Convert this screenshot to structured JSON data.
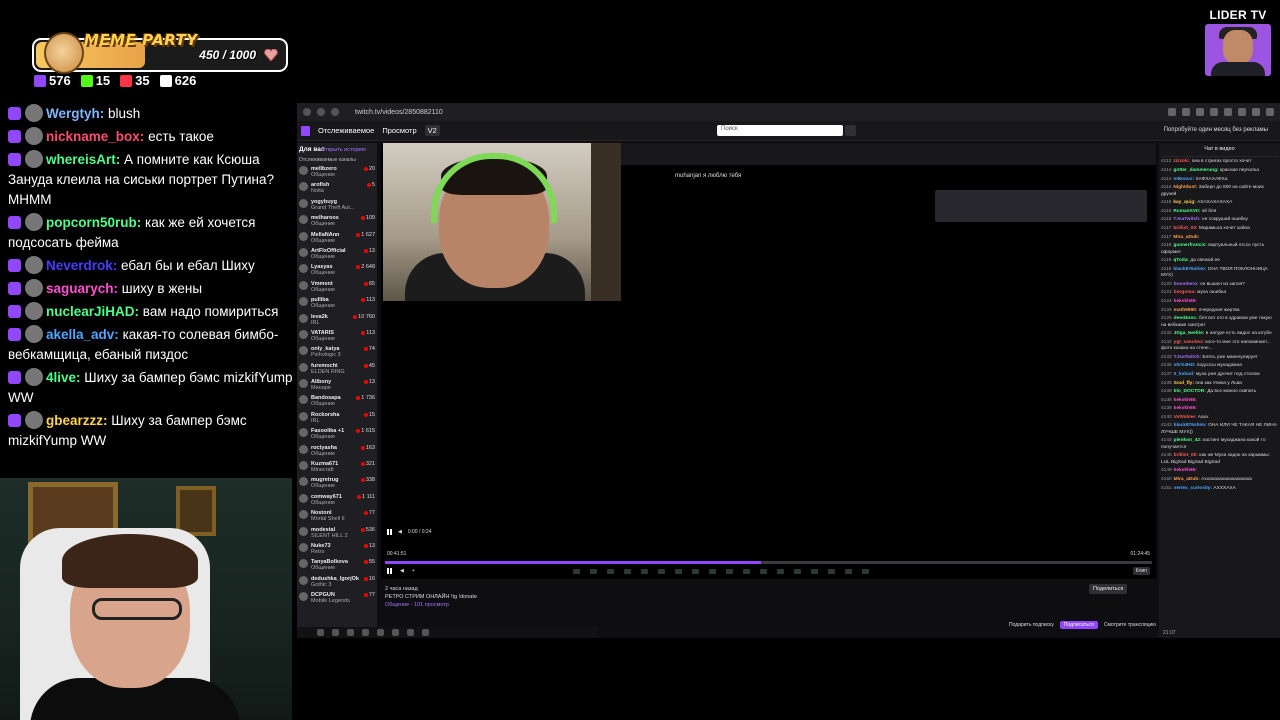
{
  "goal": {
    "title": "MEME PARTY",
    "value": "450 / 1000",
    "progress": 0.45,
    "accent": "#f6c860"
  },
  "stats": [
    {
      "icon": "twitch-icon",
      "color": "#9146ff",
      "value": "576"
    },
    {
      "icon": "kick-icon",
      "color": "#53fc18",
      "value": "15"
    },
    {
      "icon": "vk-icon",
      "color": "#ff3347",
      "value": "35"
    },
    {
      "icon": "viewers-icon",
      "color": "#ffffff",
      "value": "626"
    }
  ],
  "chat": [
    {
      "name": "Wergtyh:",
      "color": "#7fb4ff",
      "text": "blush"
    },
    {
      "name": "nickname_box:",
      "color": "#ff4d6d",
      "text": "есть такое"
    },
    {
      "name": "whereisArt:",
      "color": "#4dff88",
      "text": "А помните как Ксюша Зануда клеила на сиськи портрет Путина? МНММ"
    },
    {
      "name": "popcorn50rub:",
      "color": "#4dff88",
      "text": "как же ей хочется подсосать фейма"
    },
    {
      "name": "Neverdrok:",
      "color": "#4a3cff",
      "text": "ебал бы и ебал Шиху"
    },
    {
      "name": "saguarych:",
      "color": "#ff4fcf",
      "text": "шиху в жены"
    },
    {
      "name": "nuclearJiHAD:",
      "color": "#4dff88",
      "text": "вам надо помириться"
    },
    {
      "name": "akella_adv:",
      "color": "#4da6ff",
      "text": "какая-то солевая бимбо-вебкамщица, ебаный пиздос"
    },
    {
      "name": "4live:",
      "color": "#4dff88",
      "text": "Шиху за бампер бэмс mizkifYump WW"
    },
    {
      "name": "gbearzzz:",
      "color": "#ffd34d",
      "text": "Шиху за бампер бэмс mizkifYump WW"
    }
  ],
  "logo": {
    "text": "LIDER TV"
  },
  "browser": {
    "url": "twitch.tv/videos/2850882110",
    "nav": {
      "following": "Отслеживаемое",
      "browse": "Просмотр",
      "badge": "V2"
    },
    "search_placeholder": "Поиск",
    "promo": "Попробуйте один месяц без рекламы",
    "sidenav": {
      "title": "Для вас",
      "open_history": "Открыть историю",
      "section": "Отслеживаемые каналы",
      "channels": [
        {
          "name": "mellbzero",
          "game": "Общение",
          "viewers": "20"
        },
        {
          "name": "aroflsh",
          "game": "Noita",
          "viewers": "5"
        },
        {
          "name": "yogybuyg",
          "game": "Grand Theft Aut...",
          "viewers": ""
        },
        {
          "name": "melharoos",
          "game": "Общение",
          "viewers": "109"
        },
        {
          "name": "MellaNAnn",
          "game": "Общение",
          "viewers": "1 627"
        },
        {
          "name": "ArtFIxOfficial",
          "game": "Общение",
          "viewers": "13"
        },
        {
          "name": "Lyasyas",
          "game": "Общение",
          "viewers": "2 648"
        },
        {
          "name": "Vmment",
          "game": "Общение",
          "viewers": "65"
        },
        {
          "name": "pulliba",
          "game": "Общение",
          "viewers": "113"
        },
        {
          "name": "leva2k",
          "game": "IRL",
          "viewers": "10 760"
        },
        {
          "name": "VATARIS",
          "game": "Общение",
          "viewers": "113"
        },
        {
          "name": "only_katya",
          "game": "Psihologic 3",
          "viewers": "74"
        },
        {
          "name": "furemochi",
          "game": "ELDEN RING",
          "viewers": "45"
        },
        {
          "name": "Alibony",
          "game": "Минаре",
          "viewers": "13"
        },
        {
          "name": "Bandosapa",
          "game": "Общение",
          "viewers": "1 736"
        },
        {
          "name": "Rockorsha",
          "game": "IRL",
          "viewers": "15"
        },
        {
          "name": "Fasoolika +1",
          "game": "Общение",
          "viewers": "1 615"
        },
        {
          "name": "roctyasha",
          "game": "Общение",
          "viewers": "163"
        },
        {
          "name": "Kuzma671",
          "game": "Minecraft",
          "viewers": "321"
        },
        {
          "name": "mugretrug",
          "game": "Общение",
          "viewers": "338"
        },
        {
          "name": "comway671",
          "game": "Общение",
          "viewers": "1 111"
        },
        {
          "name": "Nostonl",
          "game": "Mortal Shell II",
          "viewers": "77"
        },
        {
          "name": "modestal",
          "game": "SILENT HILL 2",
          "viewers": "536"
        },
        {
          "name": "Nuke73",
          "game": "Retro",
          "viewers": "13"
        },
        {
          "name": "TanyaBolkova",
          "game": "Общение",
          "viewers": "55"
        },
        {
          "name": "dedushka_lgorjOk",
          "game": "Gothic 3",
          "viewers": "16"
        },
        {
          "name": "DCPGUN",
          "game": "Mobile Legends",
          "viewers": "77"
        }
      ]
    },
    "inner_title": "muhanjan я люблю тебя",
    "inner_time": "0:00 / 0:24",
    "seek": {
      "elapsed": "00:41:51",
      "total": "01:24:45",
      "progress": 0.49
    },
    "clip_label": "Клип",
    "video": {
      "ago": "2 часа назад",
      "title": "РЕТРО СТРИМ ОНЛАЙН !tg !donate",
      "category": "Общение",
      "views": "101 просмотр"
    },
    "share": "Поделиться",
    "bottom": {
      "sub": "Подарить подписку",
      "follow": "Подписаться",
      "watch": "Смотрите трансляцию"
    },
    "vchat": {
      "header": "Чат в видео",
      "messages": [
        {
          "ts": "4112",
          "user": "zizzolc:",
          "color": "#ff5a5a",
          "text": "она в стригах просто хочет"
        },
        {
          "ts": "4114",
          "user": "gotter_dammerung:",
          "color": "#4dff88",
          "text": "красная перчатка"
        },
        {
          "ts": "4114",
          "user": "mBonus:",
          "color": "#4da6ff",
          "text": "ХАФХАХАФХа"
        },
        {
          "ts": "4114",
          "user": "Nightdust:",
          "color": "#ff9f4d",
          "text": "Заберн до 800 на сайте моих друзей"
        },
        {
          "ts": "4116",
          "user": "kay_quig:",
          "color": "#ffd34d",
          "text": "АХАХАХАХАХА"
        },
        {
          "ts": "4116",
          "user": "RomanXVII:",
          "color": "#4dff88",
          "text": "ой бля"
        },
        {
          "ts": "4116",
          "user": "TJsaTwitch:",
          "color": "#a970ff",
          "text": "не сокрушай ошибку"
        },
        {
          "ts": "4117",
          "user": "brilliot_00:",
          "color": "#ff5a5a",
          "text": "Марамыга хочет хайпа"
        },
        {
          "ts": "4117",
          "user": "Mira_aDub:",
          "color": "#ff9f4d",
          "text": ""
        },
        {
          "ts": "4118",
          "user": "gunnerfrancis:",
          "color": "#4dff88",
          "text": "виртуальный отсос пусть оформит"
        },
        {
          "ts": "4119",
          "user": "qToda:",
          "color": "#4dff88",
          "text": "да свяжой ее"
        },
        {
          "ts": "4119",
          "user": "black876shim:",
          "color": "#4da6ff",
          "text": "ОНА ТВОЯ ПОКЛОННИЦА МУХ)"
        },
        {
          "ts": "4120",
          "user": "boomhero:",
          "color": "#a970ff",
          "text": "он вышел из запоя?"
        },
        {
          "ts": "4121",
          "user": "borgoma:",
          "color": "#ff5a5a",
          "text": "муха ошибка"
        },
        {
          "ts": "4124",
          "user": "kekskh65:",
          "color": "#ff4fcf",
          "text": ""
        },
        {
          "ts": "4126",
          "user": "math9990:",
          "color": "#ff9f4d",
          "text": "очередная жертва"
        },
        {
          "ts": "4129",
          "user": "deed4nnc:",
          "color": "#4dff88",
          "text": "бля вот кто в здравом уме такую на вебкаме смотрит"
        },
        {
          "ts": "4132",
          "user": "JDga_Iwelite:",
          "color": "#4dff88",
          "text": "в натуре есть видос на ютубе"
        },
        {
          "ts": "4132",
          "user": "ygt_sanchez:",
          "color": "#ff5a5a",
          "text": "кого-то мне это напоминает... фото казака на стене..."
        },
        {
          "ts": "4133",
          "user": "TJsaTwitch:",
          "color": "#a970ff",
          "text": "Блять уже маничулирует"
        },
        {
          "ts": "4136",
          "user": "shrX4HD:",
          "color": "#4da6ff",
          "text": "подсосы мухаджана"
        },
        {
          "ts": "4137",
          "user": "0_ksbad:",
          "color": "#4da6ff",
          "text": "муха уже дрочит под столом"
        },
        {
          "ts": "4138",
          "user": "Soul_fly:",
          "color": "#ffd34d",
          "text": "она как Улика у Льва"
        },
        {
          "ts": "4138",
          "user": "kto_DOCTOR:",
          "color": "#4dff88",
          "text": "Да все можно скипать"
        },
        {
          "ts": "4138",
          "user": "kekskh65:",
          "color": "#ff4fcf",
          "text": ""
        },
        {
          "ts": "4139",
          "user": "kekskh65:",
          "color": "#ff4fcf",
          "text": ""
        },
        {
          "ts": "4140",
          "user": "VolVolme:",
          "color": "#ff5a5a",
          "text": "Аахх"
        },
        {
          "ts": "4143",
          "user": "black876shim:",
          "color": "#4da6ff",
          "text": "ОНА ИЛИ ЧЕ ТАКАЯ НЕ ЛИНА ЛУЧШЕ МУХ))"
        },
        {
          "ts": "4143",
          "user": "plenkon_42:",
          "color": "#4dff88",
          "text": "кастинг мухаджана какой то получается"
        },
        {
          "ts": "4145",
          "user": "brilliot_00:",
          "color": "#ff5a5a",
          "text": "как же Муха хадок на хараммы: LUL BigSad BigSad BigSad"
        },
        {
          "ts": "4149",
          "user": "kekskh65:",
          "color": "#ff4fcf",
          "text": ""
        },
        {
          "ts": "4150",
          "user": "Mira_aDub:",
          "color": "#ff9f4d",
          "text": "Аххахахахахахахахаха"
        },
        {
          "ts": "4151",
          "user": "vertex_curiosity:",
          "color": "#4da6ff",
          "text": "АХХХАХА"
        }
      ],
      "footer": "21:07"
    }
  }
}
